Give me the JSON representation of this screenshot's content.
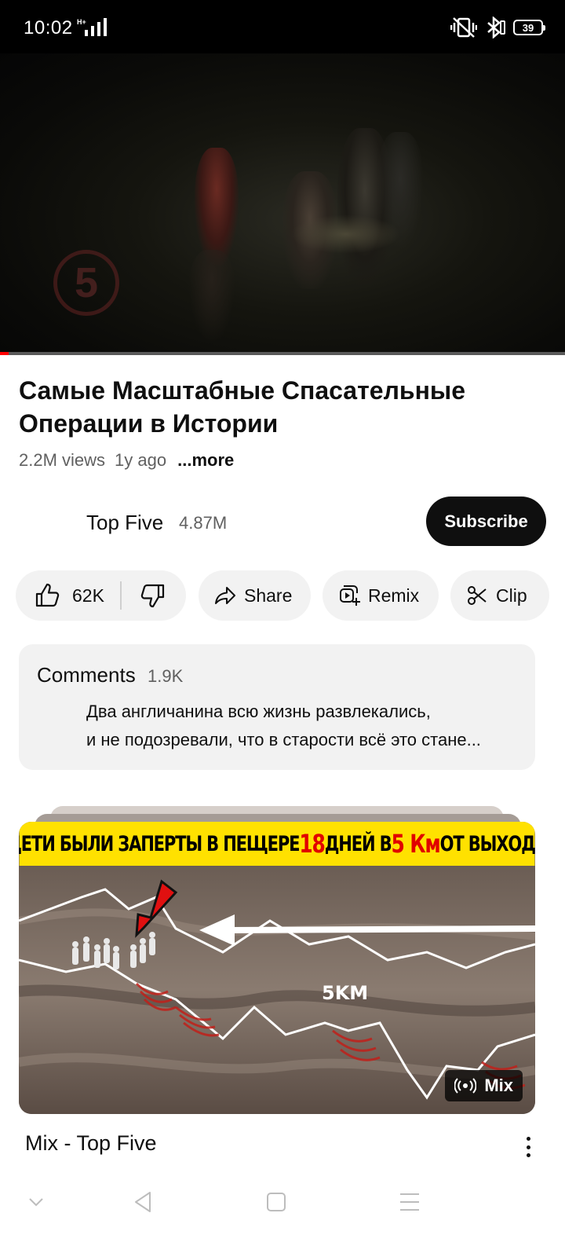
{
  "status_bar": {
    "time": "10:02",
    "network_label": "H+",
    "battery": "39"
  },
  "player": {
    "progress_fraction": 0.015,
    "watermark": "5"
  },
  "video": {
    "title": "Самые Масштабные Спасательные Операции в Истории",
    "views": "2.2M views",
    "age": "1y ago",
    "more_label": "...more"
  },
  "channel": {
    "name": "Top Five",
    "subscribers": "4.87M",
    "subscribe_label": "Subscribe"
  },
  "actions": {
    "likes": "62K",
    "share_label": "Share",
    "remix_label": "Remix",
    "clip_label": "Clip"
  },
  "comments": {
    "title": "Comments",
    "count": "1.9K",
    "preview_line1": "Два англичанина всю жизнь развлекались,",
    "preview_line2": "и не подозревали, что в старости всё это стане..."
  },
  "mix": {
    "banner_part1": "ДЕТИ БЫЛИ ЗАПЕРТЫ В ПЕЩЕРЕ ",
    "banner_num1": "18",
    "banner_part2": " ДНЕЙ В ",
    "banner_num2": "5 Км",
    "banner_part3": " ОТ ВЫХОДА",
    "distance_label": "5KM",
    "badge_label": "Mix",
    "title": "Mix - Top Five"
  },
  "colors": {
    "accent": "#ff0000",
    "subscribe_bg": "#0f0f0f",
    "pill_bg": "#f2f2f2",
    "banner_yellow": "#ffe100"
  },
  "icons": {
    "status_left": "network-signal-icon",
    "status_right": [
      "vibrate-off-icon",
      "bluetooth-icon",
      "battery-icon"
    ],
    "actions": [
      "thumbs-up-icon",
      "thumbs-down-icon",
      "share-arrow-icon",
      "remix-icon",
      "scissors-icon"
    ],
    "navigation": [
      "chevron-down-icon",
      "back-triangle-icon",
      "home-square-icon",
      "menu-lines-icon"
    ]
  }
}
